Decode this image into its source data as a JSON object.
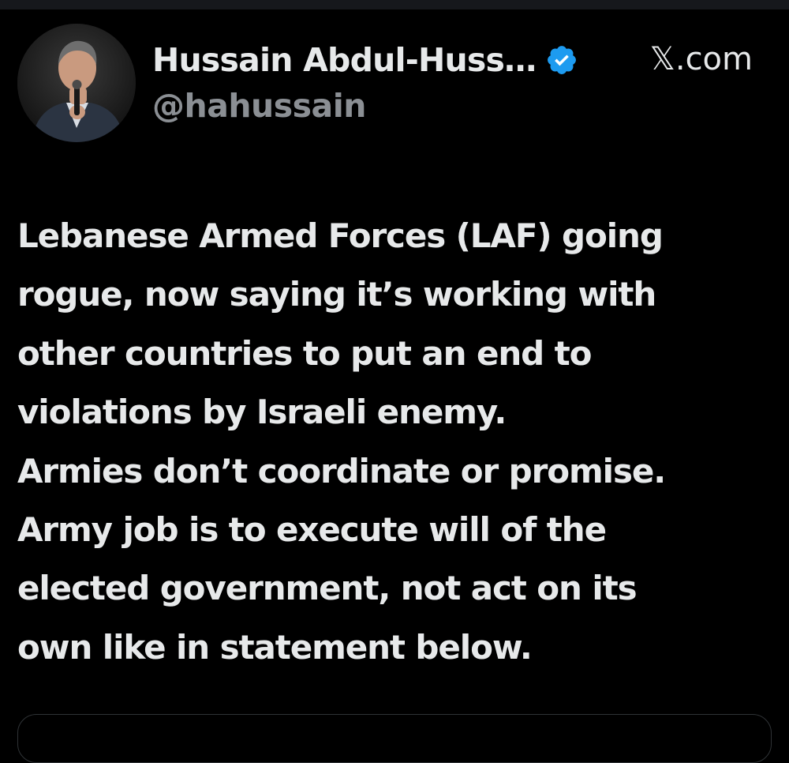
{
  "colors": {
    "background": "#000000",
    "text_primary": "#e7e9ea",
    "text_secondary": "#8b8f94",
    "verified_blue": "#1d9bf0",
    "card_border": "#2f3336"
  },
  "author": {
    "display_name": "Hussain Abdul-Huss…",
    "handle": "@hahussain",
    "verified": true,
    "verified_icon": "verified-badge-icon",
    "avatar_icon": "profile-photo-avatar"
  },
  "source": {
    "label": "𝕏.com"
  },
  "post": {
    "lines": [
      "Lebanese Armed Forces (LAF) going",
      "rogue, now saying it’s working with",
      "other countries to put an end to",
      "violations by Israeli enemy.",
      "Armies don’t coordinate or promise.",
      "Army job is to execute will of the",
      "elected government, not act on its",
      "own like in statement below."
    ]
  }
}
